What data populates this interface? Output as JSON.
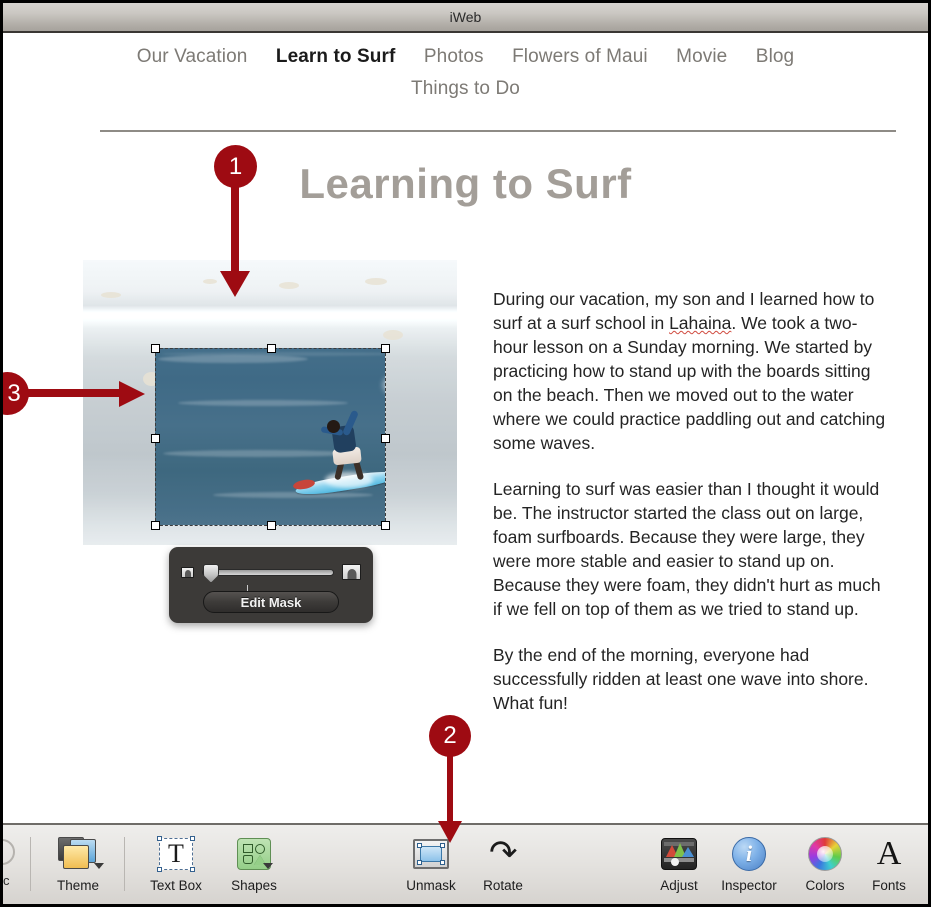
{
  "window": {
    "title": "iWeb"
  },
  "site_nav": {
    "row1": [
      {
        "label": "Our Vacation",
        "active": false
      },
      {
        "label": "Learn to Surf",
        "active": true
      },
      {
        "label": "Photos",
        "active": false
      },
      {
        "label": "Flowers of Maui",
        "active": false
      },
      {
        "label": "Movie",
        "active": false
      },
      {
        "label": "Blog",
        "active": false
      }
    ],
    "row2": [
      {
        "label": "Things to Do",
        "active": false
      }
    ]
  },
  "page": {
    "title": "Learning to Surf",
    "paragraphs": {
      "p1_before": "During our vacation, my son and I learned how to surf at a surf school in ",
      "p1_misspelled": "Lahaina",
      "p1_after": ". We took a two-hour lesson on a Sunday morning. We started by practicing how to stand up with the boards sitting on the beach. Then we moved out to the water where we could practice paddling out and catching some waves.",
      "p2": "Learning to surf was easier than I thought it would be. The instructor started the class out on large, foam surfboards. Because they were large, they were more stable and easier to stand up on. Because they were foam, they didn't hurt as much if we fell on top of them as we tried to stand up.",
      "p3": "By the end of the morning, everyone had successfully ridden at least one wave into shore. What fun!"
    }
  },
  "photo": {
    "alt": "Surfer riding a wave on a blue and white surfboard",
    "selection_state": "masked-selected"
  },
  "mask_hud": {
    "edit_mask_label": "Edit Mask",
    "small_icon": "small-photo-icon",
    "large_icon": "large-photo-icon",
    "slider_value": "0"
  },
  "toolbar": {
    "items": [
      {
        "label": "Theme",
        "icon": "theme-icon",
        "has_dropdown": true
      },
      {
        "label": "Text Box",
        "icon": "text-box-icon",
        "has_dropdown": false
      },
      {
        "label": "Shapes",
        "icon": "shapes-icon",
        "has_dropdown": true
      },
      {
        "label": "Unmask",
        "icon": "unmask-icon",
        "has_dropdown": false
      },
      {
        "label": "Rotate",
        "icon": "rotate-icon",
        "has_dropdown": false
      },
      {
        "label": "Adjust",
        "icon": "adjust-icon",
        "has_dropdown": false
      },
      {
        "label": "Inspector",
        "icon": "inspector-icon",
        "has_dropdown": false
      },
      {
        "label": "Colors",
        "icon": "colors-icon",
        "has_dropdown": false
      },
      {
        "label": "Fonts",
        "icon": "fonts-icon",
        "has_dropdown": false
      }
    ],
    "inspector_glyph": "i",
    "rotate_glyph": "↶",
    "fonts_glyph": "A",
    "text_box_glyph": "T"
  },
  "callouts": [
    {
      "number": "1",
      "points_to": "photo-top-area"
    },
    {
      "number": "2",
      "points_to": "unmask-toolbar-button"
    },
    {
      "number": "3",
      "points_to": "selection-left-handle"
    }
  ],
  "colors": {
    "callout_red": "#9e0b12",
    "nav_inactive": "#7d7a75",
    "nav_active": "#1b1b1b",
    "page_title": "#a39e98",
    "hud_background": "#3c3a38",
    "misspell_underline": "#d04a3f"
  }
}
